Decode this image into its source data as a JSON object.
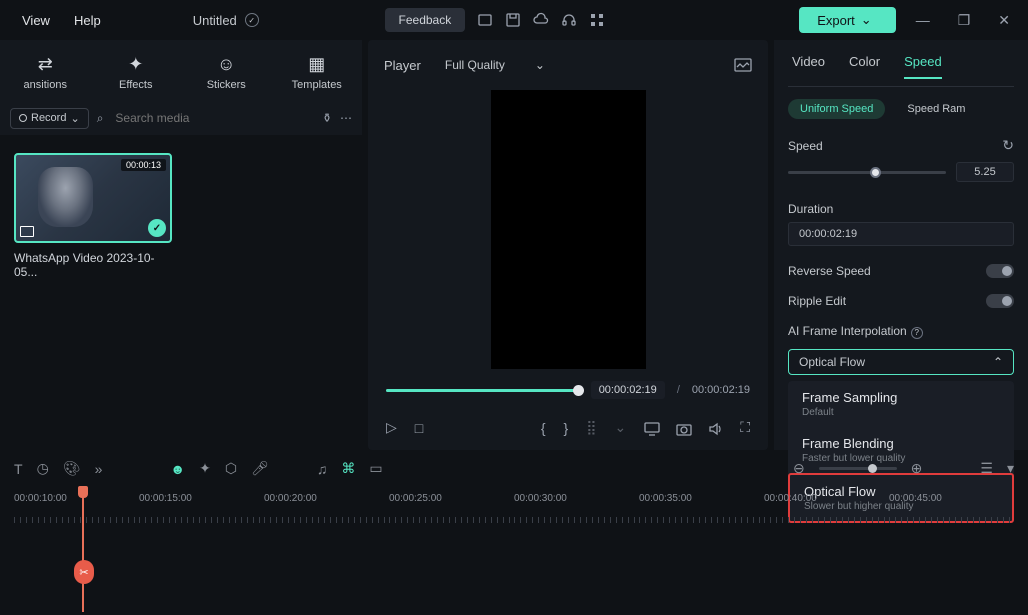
{
  "menu": {
    "view": "View",
    "help": "Help"
  },
  "doc": {
    "title": "Untitled"
  },
  "titlebar": {
    "feedback": "Feedback",
    "export": "Export"
  },
  "tabs": {
    "transitions": "ansitions",
    "effects": "Effects",
    "stickers": "Stickers",
    "templates": "Templates"
  },
  "search": {
    "record": "Record",
    "placeholder": "Search media"
  },
  "clip": {
    "duration": "00:00:13",
    "name": "WhatsApp Video 2023-10-05..."
  },
  "preview": {
    "label": "Player",
    "quality": "Full Quality",
    "current_time": "00:00:02:19",
    "total_time": "00:00:02:19",
    "separator": "/"
  },
  "inspector": {
    "tabs": {
      "video": "Video",
      "color": "Color",
      "speed": "Speed"
    },
    "subTabs": {
      "uniform": "Uniform Speed",
      "ramp": "Speed Ram"
    },
    "speed": {
      "label": "Speed",
      "value": "5.25"
    },
    "duration": {
      "label": "Duration",
      "value": "00:00:02:19"
    },
    "reverse": {
      "label": "Reverse Speed"
    },
    "ripple": {
      "label": "Ripple Edit"
    },
    "frameInterp": {
      "label": "AI Frame Interpolation",
      "selected": "Optical Flow"
    },
    "options": [
      {
        "title": "Frame Sampling",
        "desc": "Default"
      },
      {
        "title": "Frame Blending",
        "desc": "Faster but lower quality"
      },
      {
        "title": "Optical Flow",
        "desc": "Slower but higher quality"
      }
    ]
  },
  "timeline": {
    "marks": [
      "00:00:10:00",
      "00:00:15:00",
      "00:00:20:00",
      "00:00:25:00",
      "00:00:30:00",
      "00:00:35:00",
      "00:00:40:00",
      "00:00:45:00"
    ]
  }
}
